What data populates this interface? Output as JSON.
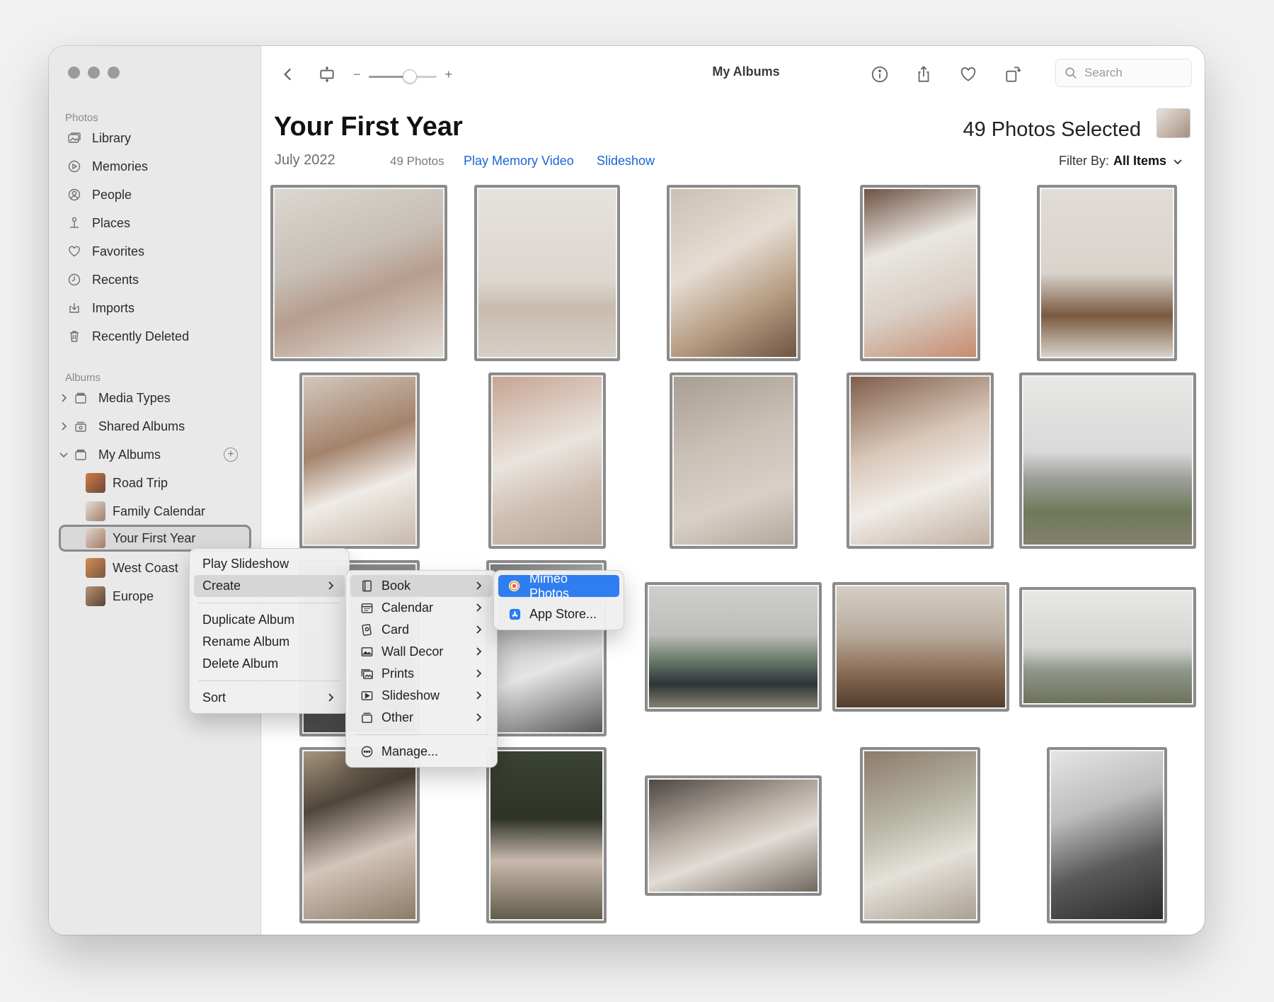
{
  "window": {
    "title": "My Albums"
  },
  "sidebar": {
    "photos_label": "Photos",
    "library_items": [
      {
        "label": "Library",
        "icon": "library-icon"
      },
      {
        "label": "Memories",
        "icon": "memories-icon"
      },
      {
        "label": "People",
        "icon": "people-icon"
      },
      {
        "label": "Places",
        "icon": "places-icon"
      },
      {
        "label": "Favorites",
        "icon": "heart-icon"
      },
      {
        "label": "Recents",
        "icon": "clock-icon"
      },
      {
        "label": "Imports",
        "icon": "import-icon"
      },
      {
        "label": "Recently Deleted",
        "icon": "trash-icon"
      }
    ],
    "albums_label": "Albums",
    "album_groups": [
      {
        "label": "Media Types",
        "expanded": false
      },
      {
        "label": "Shared Albums",
        "expanded": false
      },
      {
        "label": "My Albums",
        "expanded": true
      }
    ],
    "my_albums": [
      {
        "label": "Road Trip",
        "color": "#c0683c"
      },
      {
        "label": "Family Calendar",
        "color": "#b9a596"
      },
      {
        "label": "Your First Year",
        "color": "#a88a7a",
        "selected": true
      },
      {
        "label": "West Coast",
        "color": "#c47a48"
      },
      {
        "label": "Europe",
        "color": "#8f7058"
      }
    ]
  },
  "toolbar": {
    "slider_minus": "−",
    "slider_plus": "+",
    "zoom_level": 0.6,
    "search_placeholder": "Search"
  },
  "album": {
    "title": "Your First Year",
    "date": "July 2022",
    "photo_count": "49 Photos",
    "play_memory_video": "Play Memory Video",
    "slideshow": "Slideshow",
    "selected_text": "49 Photos Selected",
    "filter_label": "Filter By:",
    "filter_value": "All Items"
  },
  "context_menu": {
    "items": [
      "Play Slideshow",
      "Create",
      "Duplicate Album",
      "Rename Album",
      "Delete Album",
      "Sort"
    ]
  },
  "create_submenu": {
    "items": [
      {
        "label": "Book",
        "icon": "book-icon"
      },
      {
        "label": "Calendar",
        "icon": "calendar-icon"
      },
      {
        "label": "Card",
        "icon": "card-icon"
      },
      {
        "label": "Wall Decor",
        "icon": "wall-decor-icon"
      },
      {
        "label": "Prints",
        "icon": "prints-icon"
      },
      {
        "label": "Slideshow",
        "icon": "slideshow-icon"
      },
      {
        "label": "Other",
        "icon": "other-icon"
      }
    ],
    "manage": {
      "label": "Manage...",
      "icon": "ellipsis-circle-icon"
    }
  },
  "book_submenu": {
    "items": [
      {
        "label": "Mimeo Photos",
        "icon": "mimeo-icon"
      },
      {
        "label": "App Store...",
        "icon": "app-store-icon"
      }
    ]
  },
  "colors": {
    "accent": "#1a64d6",
    "menu_highlight": "#2f7df0"
  }
}
